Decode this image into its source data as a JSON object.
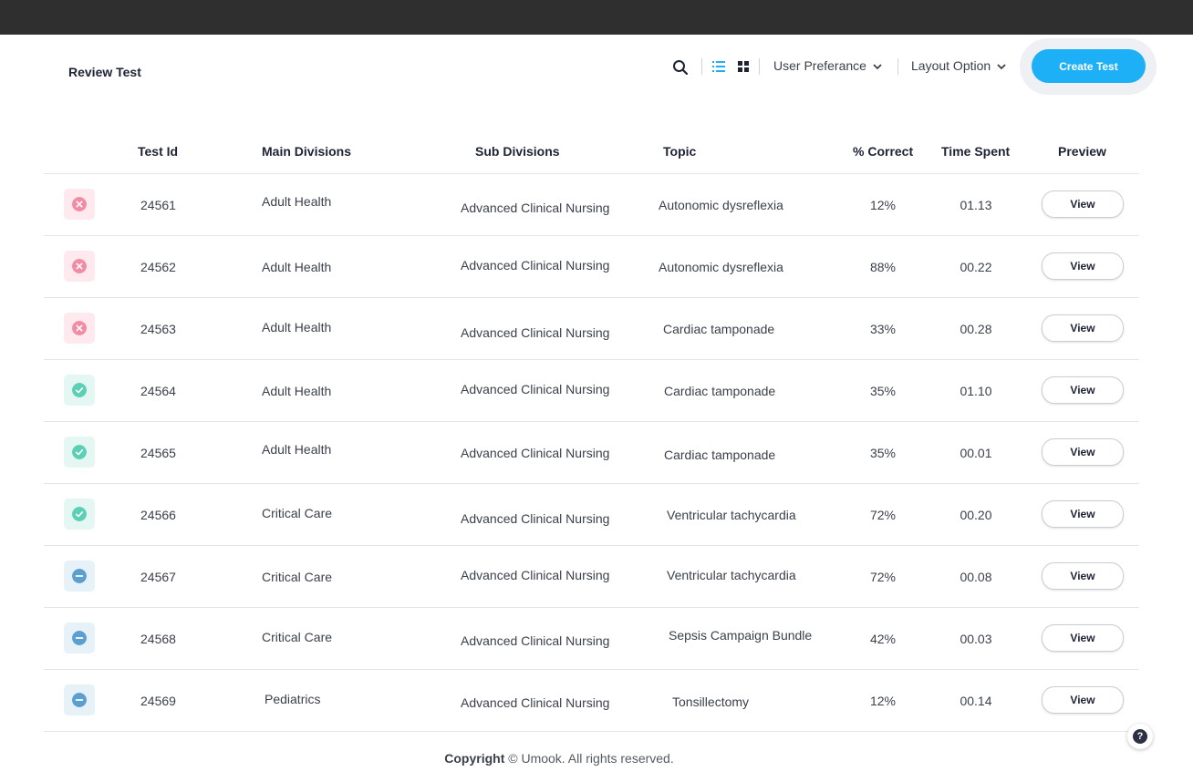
{
  "header": {
    "title": "Review Test",
    "user_preference_label": "User Preferance",
    "layout_option_label": "Layout Option",
    "create_test_label": "Create Test",
    "icons": {
      "search": "search-icon",
      "list": "list-view-icon",
      "grid": "grid-view-icon",
      "dropdown": "chevron-down-icon"
    },
    "accent_color": "#1eb0f7"
  },
  "table": {
    "columns": [
      "Test Id",
      "Main Divisions",
      "Sub Divisions",
      "Topic",
      "% Correct",
      "Time Spent",
      "Preview"
    ],
    "status_colors": {
      "fail": "#f08ca6",
      "pass": "#5ccfb4",
      "skip": "#5a9fd0"
    },
    "rows": [
      {
        "status": "fail",
        "status_icon": "x-circle-icon",
        "test_id": "24561",
        "main": "Adult Health",
        "sub": "Advanced Clinical Nursing",
        "topic": "Autonomic dysreflexia",
        "correct": "12%",
        "time": "01.13",
        "preview": "View"
      },
      {
        "status": "fail",
        "status_icon": "x-circle-icon",
        "test_id": "24562",
        "main": "Adult Health",
        "sub": "Advanced Clinical Nursing",
        "topic": "Autonomic dysreflexia",
        "correct": "88%",
        "time": "00.22",
        "preview": "View"
      },
      {
        "status": "fail",
        "status_icon": "x-circle-icon",
        "test_id": "24563",
        "main": "Adult Health",
        "sub": "Advanced Clinical Nursing",
        "topic": "Cardiac tamponade",
        "correct": "33%",
        "time": "00.28",
        "preview": "View"
      },
      {
        "status": "pass",
        "status_icon": "check-circle-icon",
        "test_id": "24564",
        "main": "Adult Health",
        "sub": "Advanced Clinical Nursing",
        "topic": "Cardiac tamponade",
        "correct": "35%",
        "time": "01.10",
        "preview": "View"
      },
      {
        "status": "pass",
        "status_icon": "check-circle-icon",
        "test_id": "24565",
        "main": "Adult Health",
        "sub": "Advanced Clinical Nursing",
        "topic": "Cardiac tamponade",
        "correct": "35%",
        "time": "00.01",
        "preview": "View"
      },
      {
        "status": "pass",
        "status_icon": "check-circle-icon",
        "test_id": "24566",
        "main": "Critical Care",
        "sub": "Advanced Clinical Nursing",
        "topic": "Ventricular tachycardia",
        "correct": "72%",
        "time": "00.20",
        "preview": "View"
      },
      {
        "status": "skip",
        "status_icon": "minus-circle-icon",
        "test_id": "24567",
        "main": "Critical Care",
        "sub": "Advanced Clinical Nursing",
        "topic": "Ventricular tachycardia",
        "correct": "72%",
        "time": "00.08",
        "preview": "View"
      },
      {
        "status": "skip",
        "status_icon": "minus-circle-icon",
        "test_id": "24568",
        "main": "Critical Care",
        "sub": "Advanced Clinical Nursing",
        "topic": "Sepsis Campaign Bundle",
        "correct": "42%",
        "time": "00.03",
        "preview": "View"
      },
      {
        "status": "skip",
        "status_icon": "minus-circle-icon",
        "test_id": "24569",
        "main": "Pediatrics",
        "sub": "Advanced Clinical Nursing",
        "topic": "Tonsillectomy",
        "correct": "12%",
        "time": "00.14",
        "preview": "View"
      }
    ]
  },
  "footer": {
    "copyright_label": "Copyright",
    "copyright_text": "© Umook. All rights reserved.",
    "help_symbol": "?",
    "help_icon": "help-icon"
  }
}
